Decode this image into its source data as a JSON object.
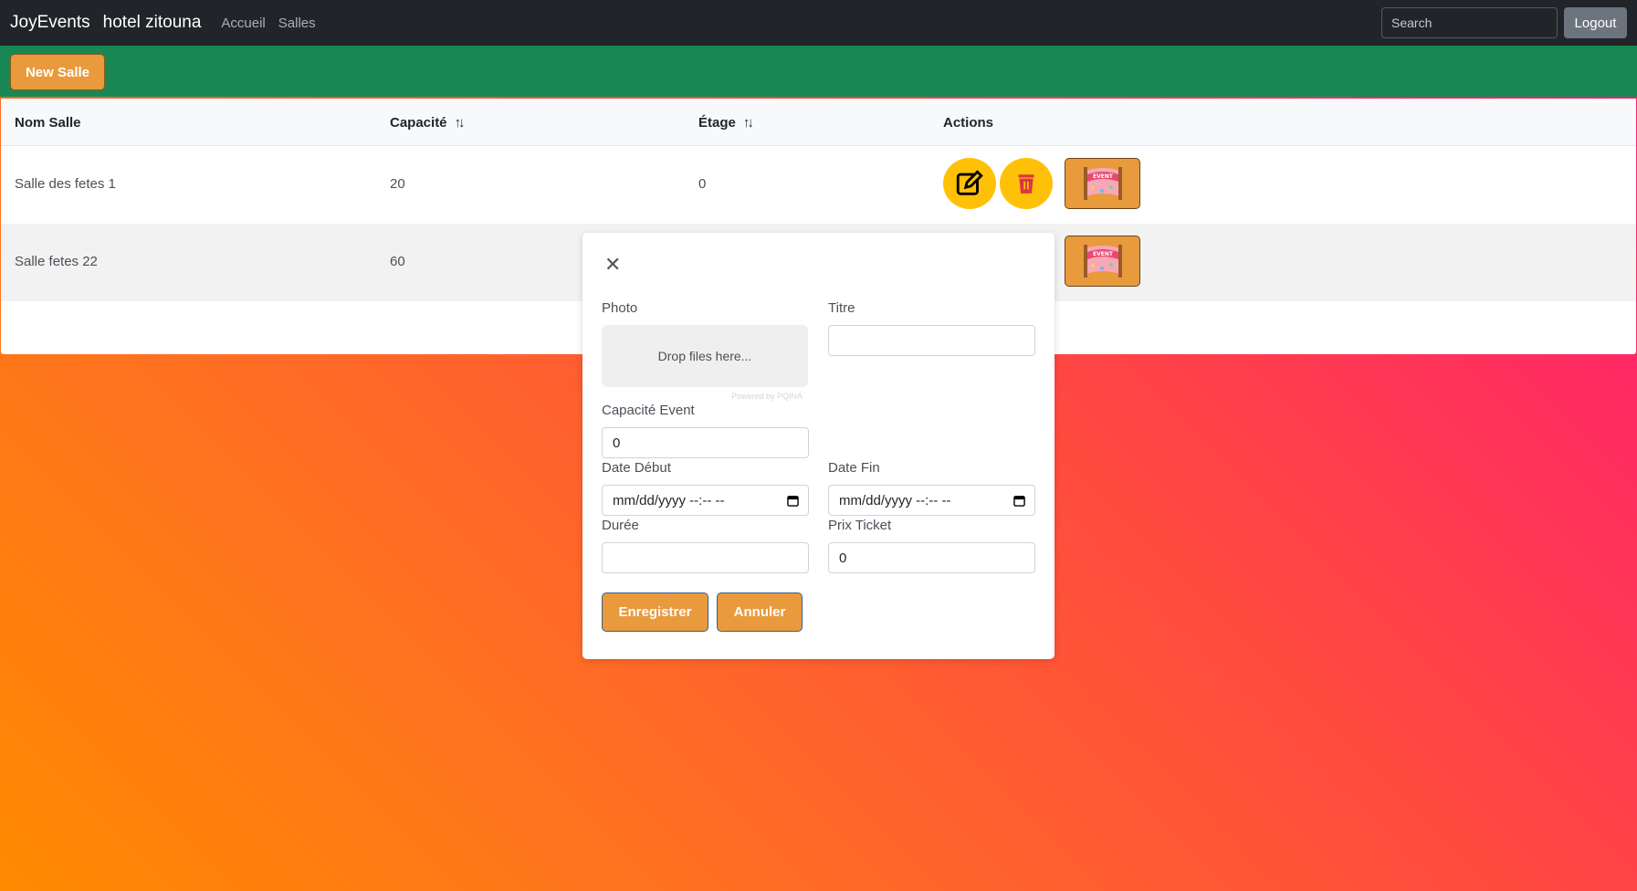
{
  "navbar": {
    "brand": "JoyEvents",
    "hotel": "hotel zitouna",
    "links": [
      "Accueil",
      "Salles"
    ],
    "search_placeholder": "Search",
    "logout_label": "Logout"
  },
  "toolbar": {
    "new_salle_label": "New Salle"
  },
  "table": {
    "headers": [
      "Nom Salle",
      "Capacité",
      "Étage",
      "Actions"
    ],
    "rows": [
      {
        "nom": "Salle des fetes 1",
        "capacite": "20",
        "etage": "0"
      },
      {
        "nom": "Salle fetes 22",
        "capacite": "60",
        "etage": ""
      }
    ],
    "event_icon_text": "EVENT"
  },
  "modal": {
    "photo_label": "Photo",
    "dropzone_text": "Drop files here...",
    "powered_by": "Powered by PQINA",
    "titre_label": "Titre",
    "titre_value": "",
    "capacite_label": "Capacité Event",
    "capacite_value": "0",
    "date_debut_label": "Date Début",
    "date_debut_placeholder": "mm/dd/yyyy --:-- --",
    "date_fin_label": "Date Fin",
    "date_fin_placeholder": "mm/dd/yyyy --:-- --",
    "duree_label": "Durée",
    "duree_value": "",
    "prix_label": "Prix Ticket",
    "prix_value": "0",
    "save_label": "Enregistrer",
    "cancel_label": "Annuler"
  },
  "colors": {
    "navbar": "#212529",
    "greenbar": "#198754",
    "accent_button": "#e99a3c",
    "round_button": "#ffc107",
    "delete_icon": "#dc3545"
  }
}
